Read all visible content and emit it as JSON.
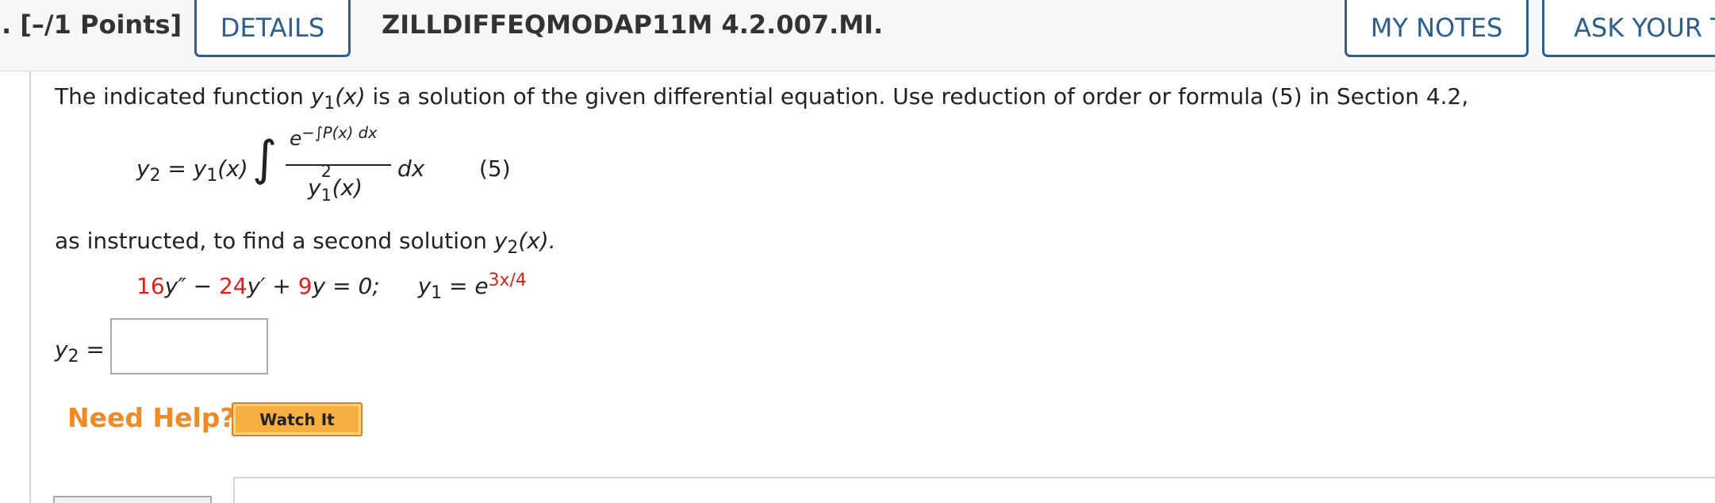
{
  "header": {
    "points": ". [–/1 Points]",
    "details_label": "DETAILS",
    "problem_id": "ZILLDIFFEQMODAP11M 4.2.007.MI.",
    "my_notes_label": "MY NOTES",
    "ask_label": "ASK YOUR T"
  },
  "problem": {
    "intro_a": "The indicated function ",
    "intro_y": "y",
    "intro_sub": "1",
    "intro_x": "(x)",
    "intro_b": " is a solution of the given differential equation. Use reduction of order or formula (5) in Section 4.2,",
    "formula": {
      "lhs_y2": "y",
      "lhs_y2_sub": "2",
      "lhs_eq": " = ",
      "lhs_y1": "y",
      "lhs_y1_sub": "1",
      "lhs_x": "(x)",
      "integral": "∫",
      "num_e": "e",
      "num_exp": "−∫P(x) dx",
      "den_y": "y",
      "den_sup": "2",
      "den_sub": "1",
      "den_x": "(x)",
      "dx": "dx",
      "eq_number": "(5)"
    },
    "instructed_a": "as instructed, to find a second solution ",
    "instructed_y": "y",
    "instructed_sub": "2",
    "instructed_x": "(x).",
    "de": {
      "c1": "16",
      "t1": "y″ − ",
      "c2": "24",
      "t2": "y′ + ",
      "c3": "9",
      "t3": "y = 0;",
      "y1": "y",
      "y1_sub": "1",
      "eq": " = e",
      "exp": "3x/4"
    },
    "answer": {
      "label_y": "y",
      "label_sub": "2",
      "label_eq": " =",
      "value": ""
    },
    "help": {
      "need_help": "Need Help?",
      "watch_it": "Watch It"
    }
  },
  "colors": {
    "accent": "#2a5f8f",
    "coefficient_red": "#e0201c",
    "help_orange": "#f08a24",
    "watch_button": "#f5b041"
  }
}
